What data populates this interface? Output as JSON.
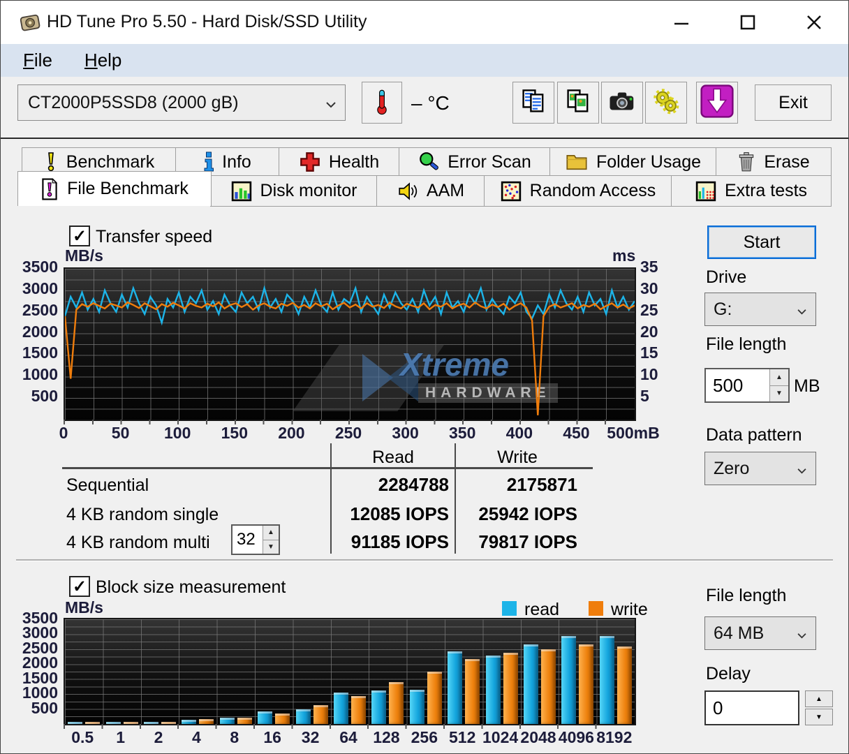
{
  "window": {
    "title": "HD Tune Pro 5.50 - Hard Disk/SSD Utility"
  },
  "menu": {
    "file_label": "File",
    "help_label": "Help"
  },
  "toolbar": {
    "device_selected": "CT2000P5SSD8 (2000 gB)",
    "temperature_label": "– °C",
    "exit_label": "Exit"
  },
  "tabs": {
    "row1": [
      {
        "label": "Benchmark",
        "icon": "exclamation-icon"
      },
      {
        "label": "Info",
        "icon": "info-icon"
      },
      {
        "label": "Health",
        "icon": "health-cross-icon"
      },
      {
        "label": "Error Scan",
        "icon": "magnifier-icon"
      },
      {
        "label": "Folder Usage",
        "icon": "folder-icon"
      },
      {
        "label": "Erase",
        "icon": "trash-icon"
      }
    ],
    "row2": [
      {
        "label": "File Benchmark",
        "icon": "file-exclamation-icon",
        "selected": true
      },
      {
        "label": "Disk monitor",
        "icon": "bar-chart-icon"
      },
      {
        "label": "AAM",
        "icon": "speaker-icon"
      },
      {
        "label": "Random Access",
        "icon": "scatter-dots-icon"
      },
      {
        "label": "Extra tests",
        "icon": "chart-grid-icon"
      }
    ]
  },
  "file_benchmark": {
    "transfer_speed_label": "Transfer speed",
    "start_button": "Start",
    "drive_label": "Drive",
    "drive_value": "G:",
    "file_length_label": "File length",
    "file_length_value": "500",
    "file_length_unit": "MB",
    "data_pattern_label": "Data pattern",
    "data_pattern_value": "Zero",
    "block_size_label": "Block size measurement",
    "file_length2_label": "File length",
    "file_length2_value": "64 MB",
    "delay_label": "Delay",
    "delay_value": "0"
  },
  "results": {
    "col_read": "Read",
    "col_write": "Write",
    "rows": [
      {
        "label": "Sequential",
        "read": "2284788",
        "write": "2175871"
      },
      {
        "label": "4 KB random single",
        "read": "12085 IOPS",
        "write": "25942 IOPS"
      },
      {
        "label": "4 KB random multi",
        "read": "91185 IOPS",
        "write": "79817 IOPS"
      }
    ],
    "queue_depth_value": "32"
  },
  "watermark": {
    "line1": "Xtreme",
    "line2": "HARDWARE"
  },
  "chart_data": [
    {
      "type": "line",
      "title": "Transfer speed",
      "ylabel": "MB/s",
      "y2label": "ms",
      "ylim": [
        0,
        3500
      ],
      "y2lim": [
        0,
        35
      ],
      "xlim": [
        0,
        500
      ],
      "y_ticks": [
        3500,
        3000,
        2500,
        2000,
        1500,
        1000,
        500
      ],
      "y2_ticks": [
        35,
        30,
        25,
        20,
        15,
        10,
        5
      ],
      "x_ticks": [
        "0",
        "50",
        "100",
        "150",
        "200",
        "250",
        "300",
        "350",
        "400",
        "450",
        "500mB"
      ],
      "grid": true,
      "x_step": 5,
      "series": [
        {
          "name": "read",
          "color": "#1db4e8",
          "values": [
            2400,
            2850,
            2600,
            2950,
            2550,
            2800,
            2500,
            3000,
            2700,
            2500,
            2900,
            2600,
            3050,
            2700,
            2450,
            2850,
            2650,
            2250,
            2800,
            2600,
            2950,
            2500,
            2850,
            2700,
            3000,
            2550,
            2750,
            2450,
            2900,
            2650,
            2500,
            2950,
            2700,
            2850,
            2550,
            3050,
            2600,
            2800,
            2500,
            2900,
            2750,
            2450,
            2850,
            2600,
            3000,
            2650,
            2500,
            2950,
            2550,
            2800,
            2700,
            3050,
            2500,
            2850,
            2650,
            2450,
            2900,
            2600,
            2950,
            2700,
            2550,
            2800,
            2500,
            3000,
            2650,
            2850,
            2450,
            2950,
            2600,
            2750,
            2500,
            2900,
            2700,
            3050,
            2550,
            2800,
            2600,
            2450,
            2850,
            2700,
            2950,
            2500,
            2350,
            2650,
            2450,
            2900,
            2600,
            3000,
            2700,
            2550,
            2850,
            2500,
            2950,
            2650,
            2800,
            2450,
            3000,
            2600,
            2850,
            2550,
            2750
          ]
        },
        {
          "name": "write",
          "color": "#ef7d0c",
          "values": [
            2400,
            950,
            2550,
            2680,
            2620,
            2700,
            2640,
            2580,
            2690,
            2650,
            2600,
            2720,
            2660,
            2590,
            2700,
            2630,
            2560,
            2680,
            2620,
            2710,
            2650,
            2580,
            2700,
            2640,
            2600,
            2690,
            2630,
            2720,
            2580,
            2660,
            2700,
            2610,
            2680,
            2550,
            2650,
            2700,
            2620,
            2580,
            2690,
            2640,
            2710,
            2600,
            2660,
            2580,
            2700,
            2630,
            2690,
            2560,
            2650,
            2710,
            2600,
            2670,
            2580,
            2700,
            2620,
            2660,
            2590,
            2710,
            2630,
            2580,
            2690,
            2640,
            2600,
            2700,
            2560,
            2660,
            2620,
            2700,
            2580,
            2650,
            2690,
            2600,
            2720,
            2630,
            2580,
            2670,
            2610,
            2690,
            2550,
            2640,
            2700,
            2600,
            2300,
            100,
            2400,
            2620,
            2680,
            2600,
            2650,
            2700,
            2580,
            2660,
            2620,
            2690,
            2560,
            2640,
            2700,
            2600,
            2670,
            2580,
            2650
          ]
        }
      ]
    },
    {
      "type": "bar",
      "title": "Block size measurement",
      "ylabel": "MB/s",
      "ylim": [
        0,
        3500
      ],
      "y_ticks": [
        3500,
        3000,
        2500,
        2000,
        1500,
        1000,
        500
      ],
      "categories": [
        "0.5",
        "1",
        "2",
        "4",
        "8",
        "16",
        "32",
        "64",
        "128",
        "256",
        "512",
        "1024",
        "2048",
        "4096",
        "8192"
      ],
      "legend": [
        "read",
        "write"
      ],
      "legend_position": "top-right",
      "grid": true,
      "series": [
        {
          "name": "read",
          "color": "#1db4e8",
          "values": [
            40,
            55,
            75,
            150,
            215,
            420,
            500,
            1050,
            1120,
            1150,
            2430,
            2280,
            2650,
            2950,
            2950
          ]
        },
        {
          "name": "write",
          "color": "#ef7d0c",
          "values": [
            40,
            50,
            60,
            165,
            200,
            350,
            640,
            940,
            1400,
            1750,
            2160,
            2380,
            2500,
            2660,
            2600
          ]
        }
      ]
    }
  ]
}
